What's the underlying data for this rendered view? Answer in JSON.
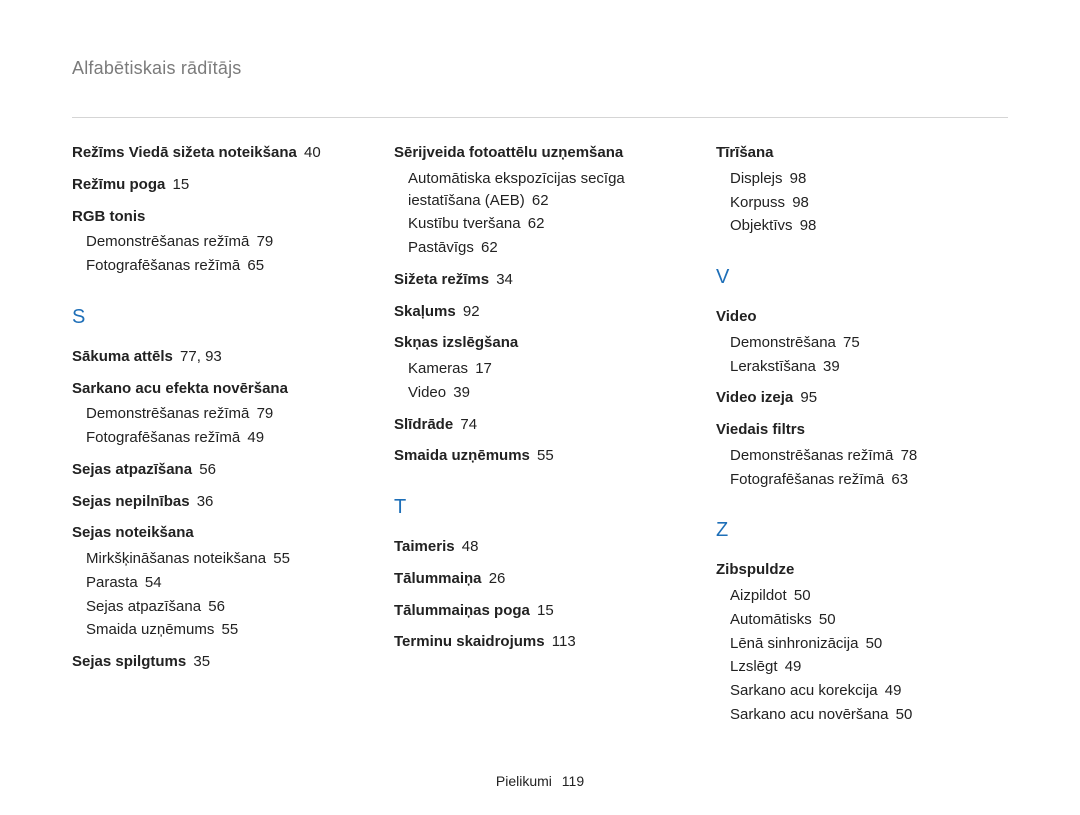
{
  "page_title": "Alfabētiskais rādītājs",
  "footer": {
    "label": "Pielikumi",
    "page": "119"
  },
  "columns": [
    [
      {
        "type": "entry",
        "term": "Režīms Viedā sižeta noteikšana",
        "pages": "40"
      },
      {
        "type": "entry",
        "term": "Režīmu poga",
        "pages": "15"
      },
      {
        "type": "entry",
        "term": "RGB tonis",
        "subs": [
          {
            "label": "Demonstrēšanas režīmā",
            "pages": "79"
          },
          {
            "label": "Fotografēšanas režīmā",
            "pages": "65"
          }
        ]
      },
      {
        "type": "letter",
        "label": "S"
      },
      {
        "type": "entry",
        "term": "Sākuma attēls",
        "pages": "77, 93"
      },
      {
        "type": "entry",
        "term": "Sarkano acu efekta novēršana",
        "subs": [
          {
            "label": "Demonstrēšanas režīmā",
            "pages": "79"
          },
          {
            "label": "Fotografēšanas režīmā",
            "pages": "49"
          }
        ]
      },
      {
        "type": "entry",
        "term": "Sejas atpazīšana",
        "pages": "56"
      },
      {
        "type": "entry",
        "term": "Sejas nepilnības",
        "pages": "36"
      },
      {
        "type": "entry",
        "term": "Sejas noteikšana",
        "subs": [
          {
            "label": "Mirkšķināšanas noteikšana",
            "pages": "55"
          },
          {
            "label": "Parasta",
            "pages": "54"
          },
          {
            "label": "Sejas atpazīšana",
            "pages": "56"
          },
          {
            "label": "Smaida uzņēmums",
            "pages": "55"
          }
        ]
      },
      {
        "type": "entry",
        "term": "Sejas spilgtums",
        "pages": "35"
      }
    ],
    [
      {
        "type": "entry",
        "term": "Sērijveida fotoattēlu uzņemšana",
        "subs": [
          {
            "label": "Automātiska ekspozīcijas secīga iestatīšana (AEB)",
            "pages": "62"
          },
          {
            "label": "Kustību tveršana",
            "pages": "62"
          },
          {
            "label": "Pastāvīgs",
            "pages": "62"
          }
        ]
      },
      {
        "type": "entry",
        "term": "Sižeta režīms",
        "pages": "34"
      },
      {
        "type": "entry",
        "term": "Skaļums",
        "pages": "92"
      },
      {
        "type": "entry",
        "term": "Skņas izslēgšana",
        "subs": [
          {
            "label": "Kameras",
            "pages": "17"
          },
          {
            "label": "Video",
            "pages": "39"
          }
        ]
      },
      {
        "type": "entry",
        "term": "Slīdrāde",
        "pages": "74"
      },
      {
        "type": "entry",
        "term": "Smaida uzņēmums",
        "pages": "55"
      },
      {
        "type": "letter",
        "label": "T"
      },
      {
        "type": "entry",
        "term": "Taimeris",
        "pages": "48"
      },
      {
        "type": "entry",
        "term": "Tālummaiņa",
        "pages": "26"
      },
      {
        "type": "entry",
        "term": "Tālummaiņas poga",
        "pages": "15"
      },
      {
        "type": "entry",
        "term": "Terminu skaidrojums",
        "pages": "113"
      }
    ],
    [
      {
        "type": "entry",
        "term": "Tīrīšana",
        "subs": [
          {
            "label": "Displejs",
            "pages": "98"
          },
          {
            "label": "Korpuss",
            "pages": "98"
          },
          {
            "label": "Objektīvs",
            "pages": "98"
          }
        ]
      },
      {
        "type": "letter",
        "label": "V"
      },
      {
        "type": "entry",
        "term": "Video",
        "subs": [
          {
            "label": "Demonstrēšana",
            "pages": "75"
          },
          {
            "label": "Lerakstīšana",
            "pages": "39"
          }
        ]
      },
      {
        "type": "entry",
        "term": "Video izeja",
        "pages": "95"
      },
      {
        "type": "entry",
        "term": "Viedais filtrs",
        "subs": [
          {
            "label": "Demonstrēšanas režīmā",
            "pages": "78"
          },
          {
            "label": "Fotografēšanas režīmā",
            "pages": "63"
          }
        ]
      },
      {
        "type": "letter",
        "label": "Z"
      },
      {
        "type": "entry",
        "term": "Zibspuldze",
        "subs": [
          {
            "label": "Aizpildot",
            "pages": "50"
          },
          {
            "label": "Automātisks",
            "pages": "50"
          },
          {
            "label": "Lēnā sinhronizācija",
            "pages": "50"
          },
          {
            "label": "Lzslēgt",
            "pages": "49"
          },
          {
            "label": "Sarkano acu korekcija",
            "pages": "49"
          },
          {
            "label": "Sarkano acu novēršana",
            "pages": "50"
          }
        ]
      }
    ]
  ]
}
